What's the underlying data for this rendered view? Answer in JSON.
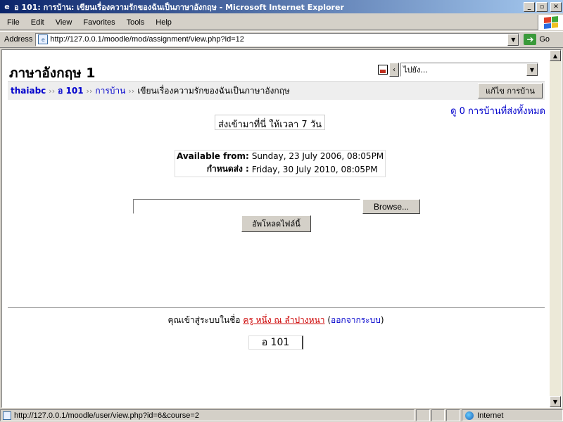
{
  "window": {
    "title": "อ 101: การบ้าน: เขียนเรื่องความรักของฉันเป็นภาษาอังกฤษ - Microsoft Internet Explorer",
    "controls": {
      "minimize": "_",
      "maximize": "▫",
      "close": "✕"
    }
  },
  "menu": [
    "File",
    "Edit",
    "View",
    "Favorites",
    "Tools",
    "Help"
  ],
  "address": {
    "label": "Address",
    "url": "http://127.0.0.1/moodle/mod/assignment/view.php?id=12",
    "go_label": "Go"
  },
  "page": {
    "course_title": "ภาษาอังกฤษ 1",
    "jump_select": "ไปยัง...",
    "breadcrumb": [
      {
        "label": "thaiabc",
        "link": true
      },
      {
        "label": "อ 101",
        "link": true
      },
      {
        "label": "การบ้าน",
        "link": true,
        "plain": true
      },
      {
        "label": "เขียนเรื่องความรักของฉันเป็นภาษาอังกฤษ",
        "link": false
      }
    ],
    "breadcrumb_sep": "››",
    "edit_button": "แก้ไข การบ้าน",
    "view_submissions": "ดู 0 การบ้านที่ส่งทั้งหมด",
    "due_message": "ส่งเข้ามาที่นี่ ให้เวลา 7 วัน",
    "dates": [
      {
        "label": "Available from:",
        "value": "Sunday, 23 July 2006, 08:05PM"
      },
      {
        "label": "กำหนดส่ง :",
        "value": "Friday, 30 July 2010, 08:05PM"
      }
    ],
    "file_input_value": "",
    "browse_button": "Browse...",
    "upload_button": "อัพโหลดไฟล์นี้",
    "login": {
      "prefix": "คุณเข้าสู่ระบบในชื่อ ",
      "user": "ครู หนึ่ง ณ ลำปางหนา",
      "open_paren": " (",
      "logout": "ออกจากระบบ",
      "close_paren": ")"
    },
    "home_link": "อ 101"
  },
  "status": {
    "url": "http://127.0.0.1/moodle/user/view.php?id=6&course=2",
    "zone": "Internet"
  }
}
